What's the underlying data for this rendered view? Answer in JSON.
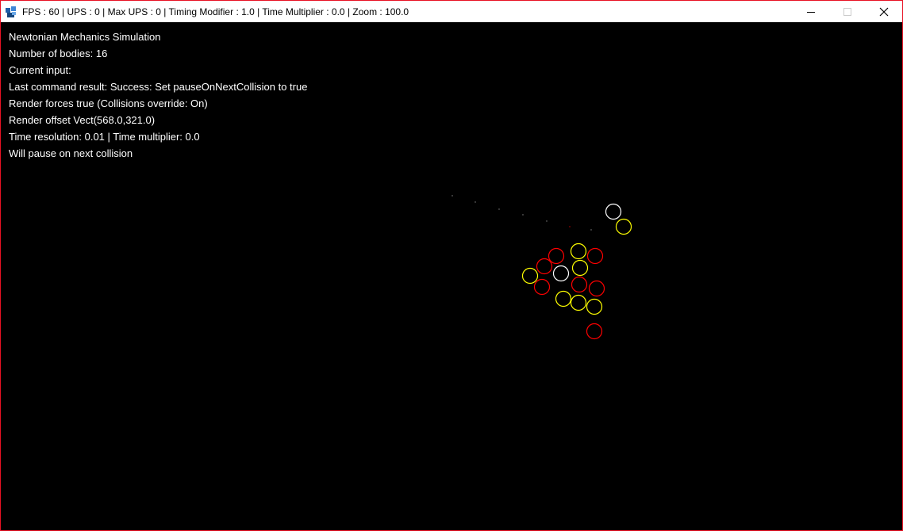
{
  "window": {
    "title": "FPS : 60 | UPS : 0 | Max UPS : 0 | Timing Modifier : 1.0 | Time Multiplier : 0.0 | Zoom : 100.0",
    "border_color": "#e81123"
  },
  "overlay": {
    "lines": [
      "Newtonian Mechanics Simulation",
      "Number of bodies: 16",
      "Current input:",
      "Last command result: Success: Set pauseOnNextCollision to true",
      "Render forces true (Collisions override: On)",
      "Render offset Vect(568.0,321.0)",
      "Time resolution: 0.01 | Time multiplier: 0.0",
      "Will pause on next collision"
    ]
  },
  "simulation": {
    "body_count": 16,
    "colors": {
      "white": "#ffffff",
      "yellow": "#ffff00",
      "red": "#ff0000"
    }
  },
  "icons": {
    "app": "java-app-icon",
    "minimize": "minimize-icon",
    "maximize": "maximize-icon",
    "close": "close-icon"
  }
}
